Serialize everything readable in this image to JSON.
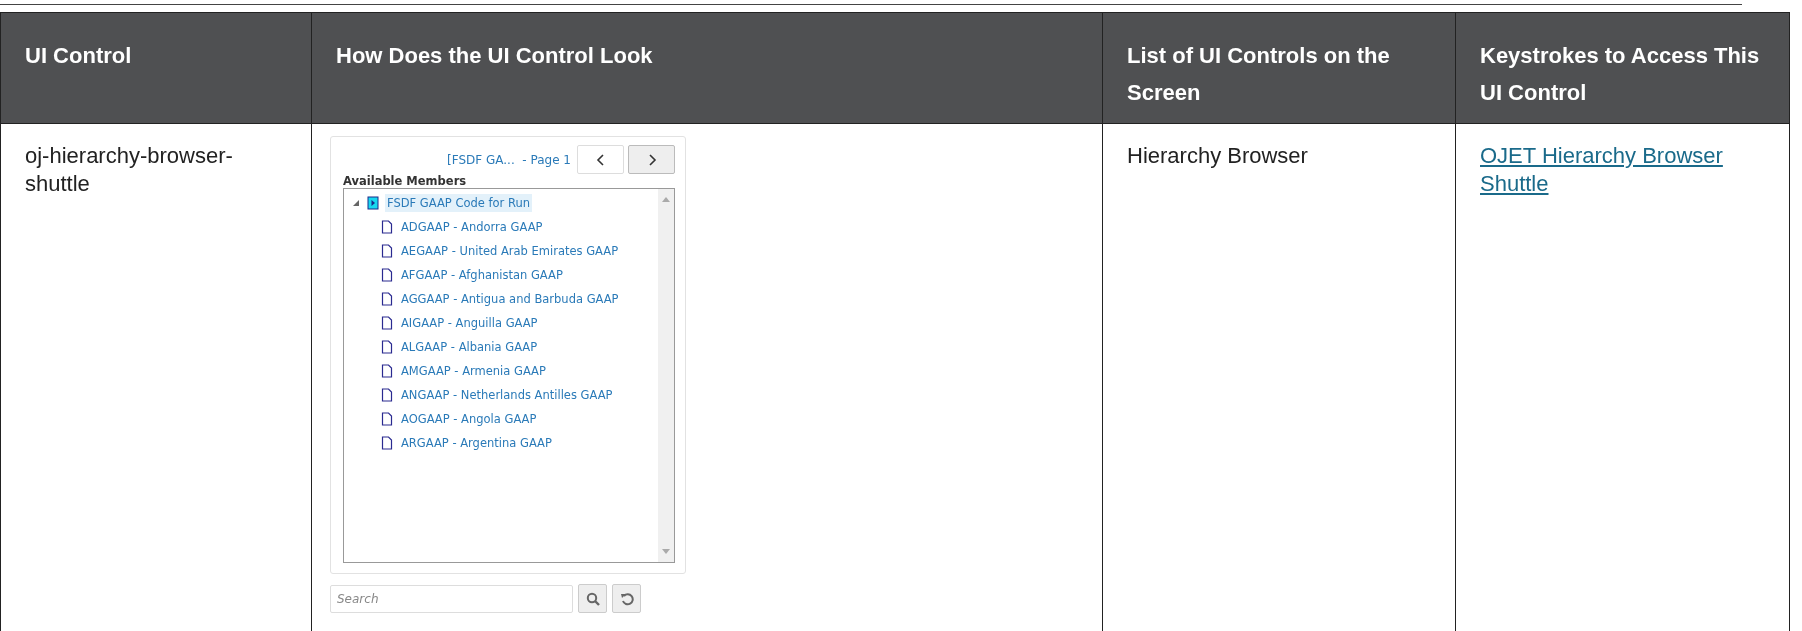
{
  "table": {
    "columns": [
      "UI Control",
      "How Does the UI Control Look",
      "List of UI Controls on the Screen",
      "Keystrokes to Access This UI Control"
    ],
    "rows": [
      {
        "control": "oj-hierarchy-browser-shuttle",
        "preview": {
          "pager": "[FSDF GA...  - Page 1",
          "heading": "Available Members",
          "tree": [
            {
              "label": "FSDF GAAP Code for Run",
              "selected": true,
              "expanded": true,
              "children": [
                {
                  "label": "ADGAAP - Andorra GAAP",
                  "selected": false
                },
                {
                  "label": "AEGAAP - United Arab Emirates GAAP",
                  "selected": false
                },
                {
                  "label": "AFGAAP - Afghanistan GAAP",
                  "selected": false
                },
                {
                  "label": "AGGAAP - Antigua and Barbuda GAAP",
                  "selected": false
                },
                {
                  "label": "AIGAAP - Anguilla GAAP",
                  "selected": false
                },
                {
                  "label": "ALGAAP - Albania GAAP",
                  "selected": false
                },
                {
                  "label": "AMGAAP - Armenia GAAP",
                  "selected": false
                },
                {
                  "label": "ANGAAP - Netherlands Antilles GAAP",
                  "selected": false
                },
                {
                  "label": "AOGAAP - Angola GAAP",
                  "selected": false
                },
                {
                  "label": "ARGAAP - Argentina GAAP",
                  "selected": false
                }
              ]
            }
          ],
          "search": {
            "placeholder": "Search"
          }
        },
        "list": "Hierarchy Browser",
        "link": "OJET Hierarchy Browser Shuttle"
      }
    ]
  }
}
